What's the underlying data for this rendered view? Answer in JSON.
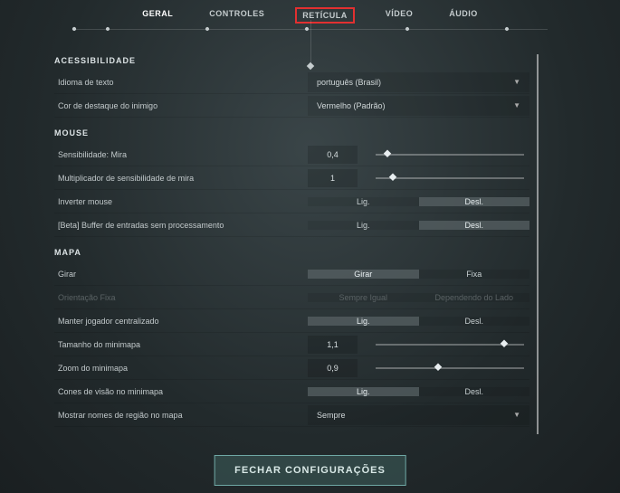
{
  "tabs": {
    "general": "GERAL",
    "controls": "CONTROLES",
    "crosshair": "RETÍCULA",
    "video": "VÍDEO",
    "audio": "ÁUDIO"
  },
  "sections": {
    "accessibility": {
      "title": "ACESSIBILIDADE",
      "text_language": {
        "label": "Idioma de texto",
        "value": "português (Brasil)"
      },
      "enemy_highlight": {
        "label": "Cor de destaque do inimigo",
        "value": "Vermelho (Padrão)"
      }
    },
    "mouse": {
      "title": "MOUSE",
      "sensitivity": {
        "label": "Sensibilidade: Mira",
        "value": "0,4"
      },
      "scoped_mult": {
        "label": "Multiplicador de sensibilidade de mira",
        "value": "1"
      },
      "invert": {
        "label": "Inverter mouse",
        "on": "Lig.",
        "off": "Desl."
      },
      "raw_input": {
        "label": "[Beta] Buffer de entradas sem processamento",
        "on": "Lig.",
        "off": "Desl."
      }
    },
    "map": {
      "title": "MAPA",
      "rotate": {
        "label": "Girar",
        "opt_rotate": "Girar",
        "opt_fixed": "Fixa"
      },
      "fixed_orientation": {
        "label": "Orientação Fixa",
        "opt_same": "Sempre Igual",
        "opt_side": "Dependendo do Lado"
      },
      "keep_centered": {
        "label": "Manter jogador centralizado",
        "on": "Lig.",
        "off": "Desl."
      },
      "minimap_size": {
        "label": "Tamanho do minimapa",
        "value": "1,1"
      },
      "minimap_zoom": {
        "label": "Zoom do minimapa",
        "value": "0,9"
      },
      "vision_cones": {
        "label": "Cones de visão no minimapa",
        "on": "Lig.",
        "off": "Desl."
      },
      "region_names": {
        "label": "Mostrar nomes de região no mapa",
        "value": "Sempre"
      }
    }
  },
  "close_button": "FECHAR CONFIGURAÇÕES"
}
